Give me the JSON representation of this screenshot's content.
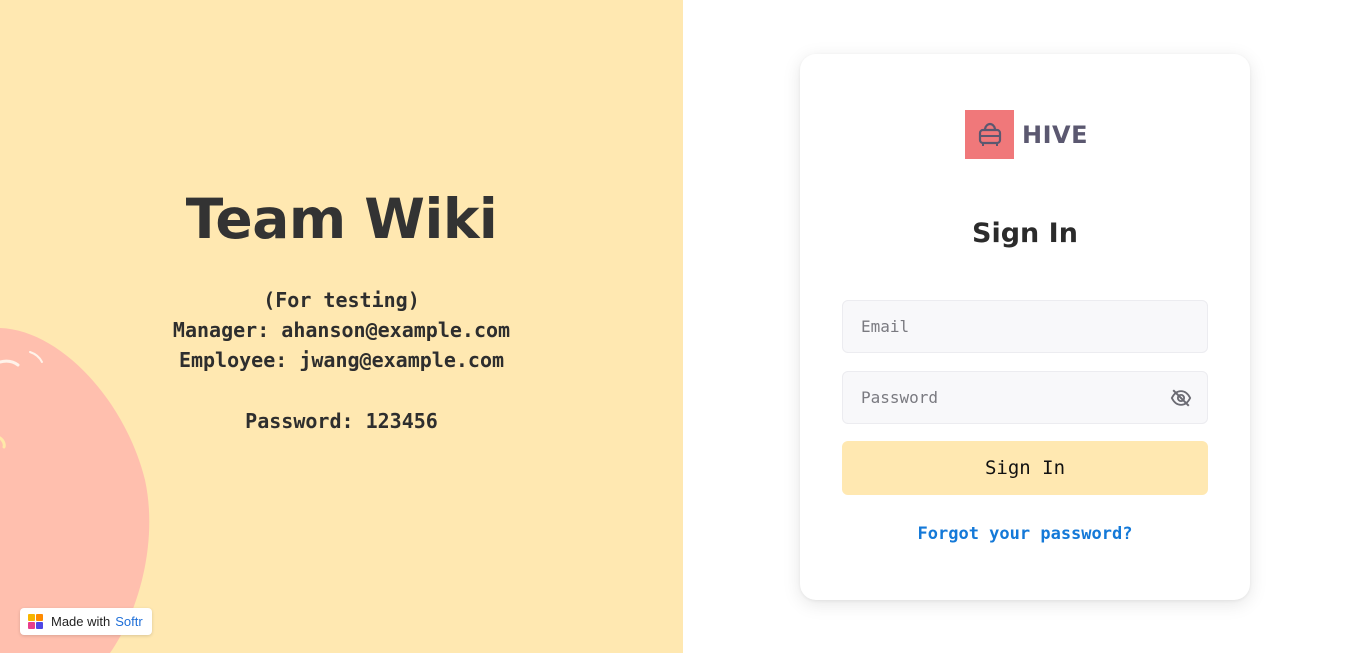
{
  "hero": {
    "title": "Team Wiki",
    "lines": [
      "(For testing)",
      "Manager: ahanson@example.com",
      "Employee: jwang@example.com",
      "Password: 123456"
    ]
  },
  "badge": {
    "text": "Made with",
    "brand": "Softr",
    "logo_colors": [
      "#f7b500",
      "#ff8a00",
      "#e83e8c",
      "#4f46e5"
    ]
  },
  "logo": {
    "name": "HIVE",
    "icon": "bag-icon",
    "box_color": "#f0787a"
  },
  "form": {
    "title": "Sign In",
    "email_placeholder": "Email",
    "password_placeholder": "Password",
    "password_toggle_icon": "eye-off-icon",
    "submit_label": "Sign In",
    "forgot_label": "Forgot your password?"
  },
  "colors": {
    "left_background": "#ffe8b1",
    "blob": "#ffbfae",
    "link": "#1479d8",
    "button": "#ffe8b1"
  }
}
